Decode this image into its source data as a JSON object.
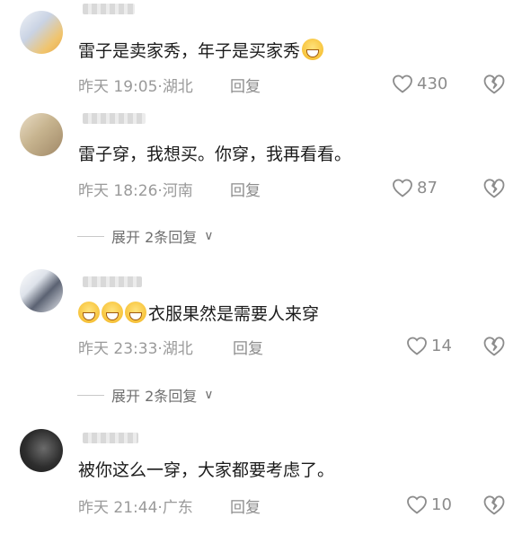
{
  "comments": [
    {
      "text": "雷子是卖家秀，年子是买家秀",
      "emoji_after": "grinning-sweat-emoji",
      "time": "昨天 19:05",
      "location": "湖北",
      "reply_label": "回复",
      "likes": "430"
    },
    {
      "text": "雷子穿，我想买。你穿，我再看看。",
      "time": "昨天 18:26",
      "location": "河南",
      "reply_label": "回复",
      "likes": "87",
      "expand_label": "展开 2条回复"
    },
    {
      "text": "衣服果然是需要人来穿",
      "emoji_before_count": 3,
      "time": "昨天 23:33",
      "location": "湖北",
      "reply_label": "回复",
      "likes": "14",
      "expand_label": "展开 2条回复"
    },
    {
      "text": "被你这么一穿，大家都要考虑了。",
      "time": "昨天 21:44",
      "location": "广东",
      "reply_label": "回复",
      "likes": "10"
    }
  ],
  "colors": {
    "text": "#1b1b1b",
    "meta": "#9a9a9a",
    "icon": "#8c8c8c"
  }
}
